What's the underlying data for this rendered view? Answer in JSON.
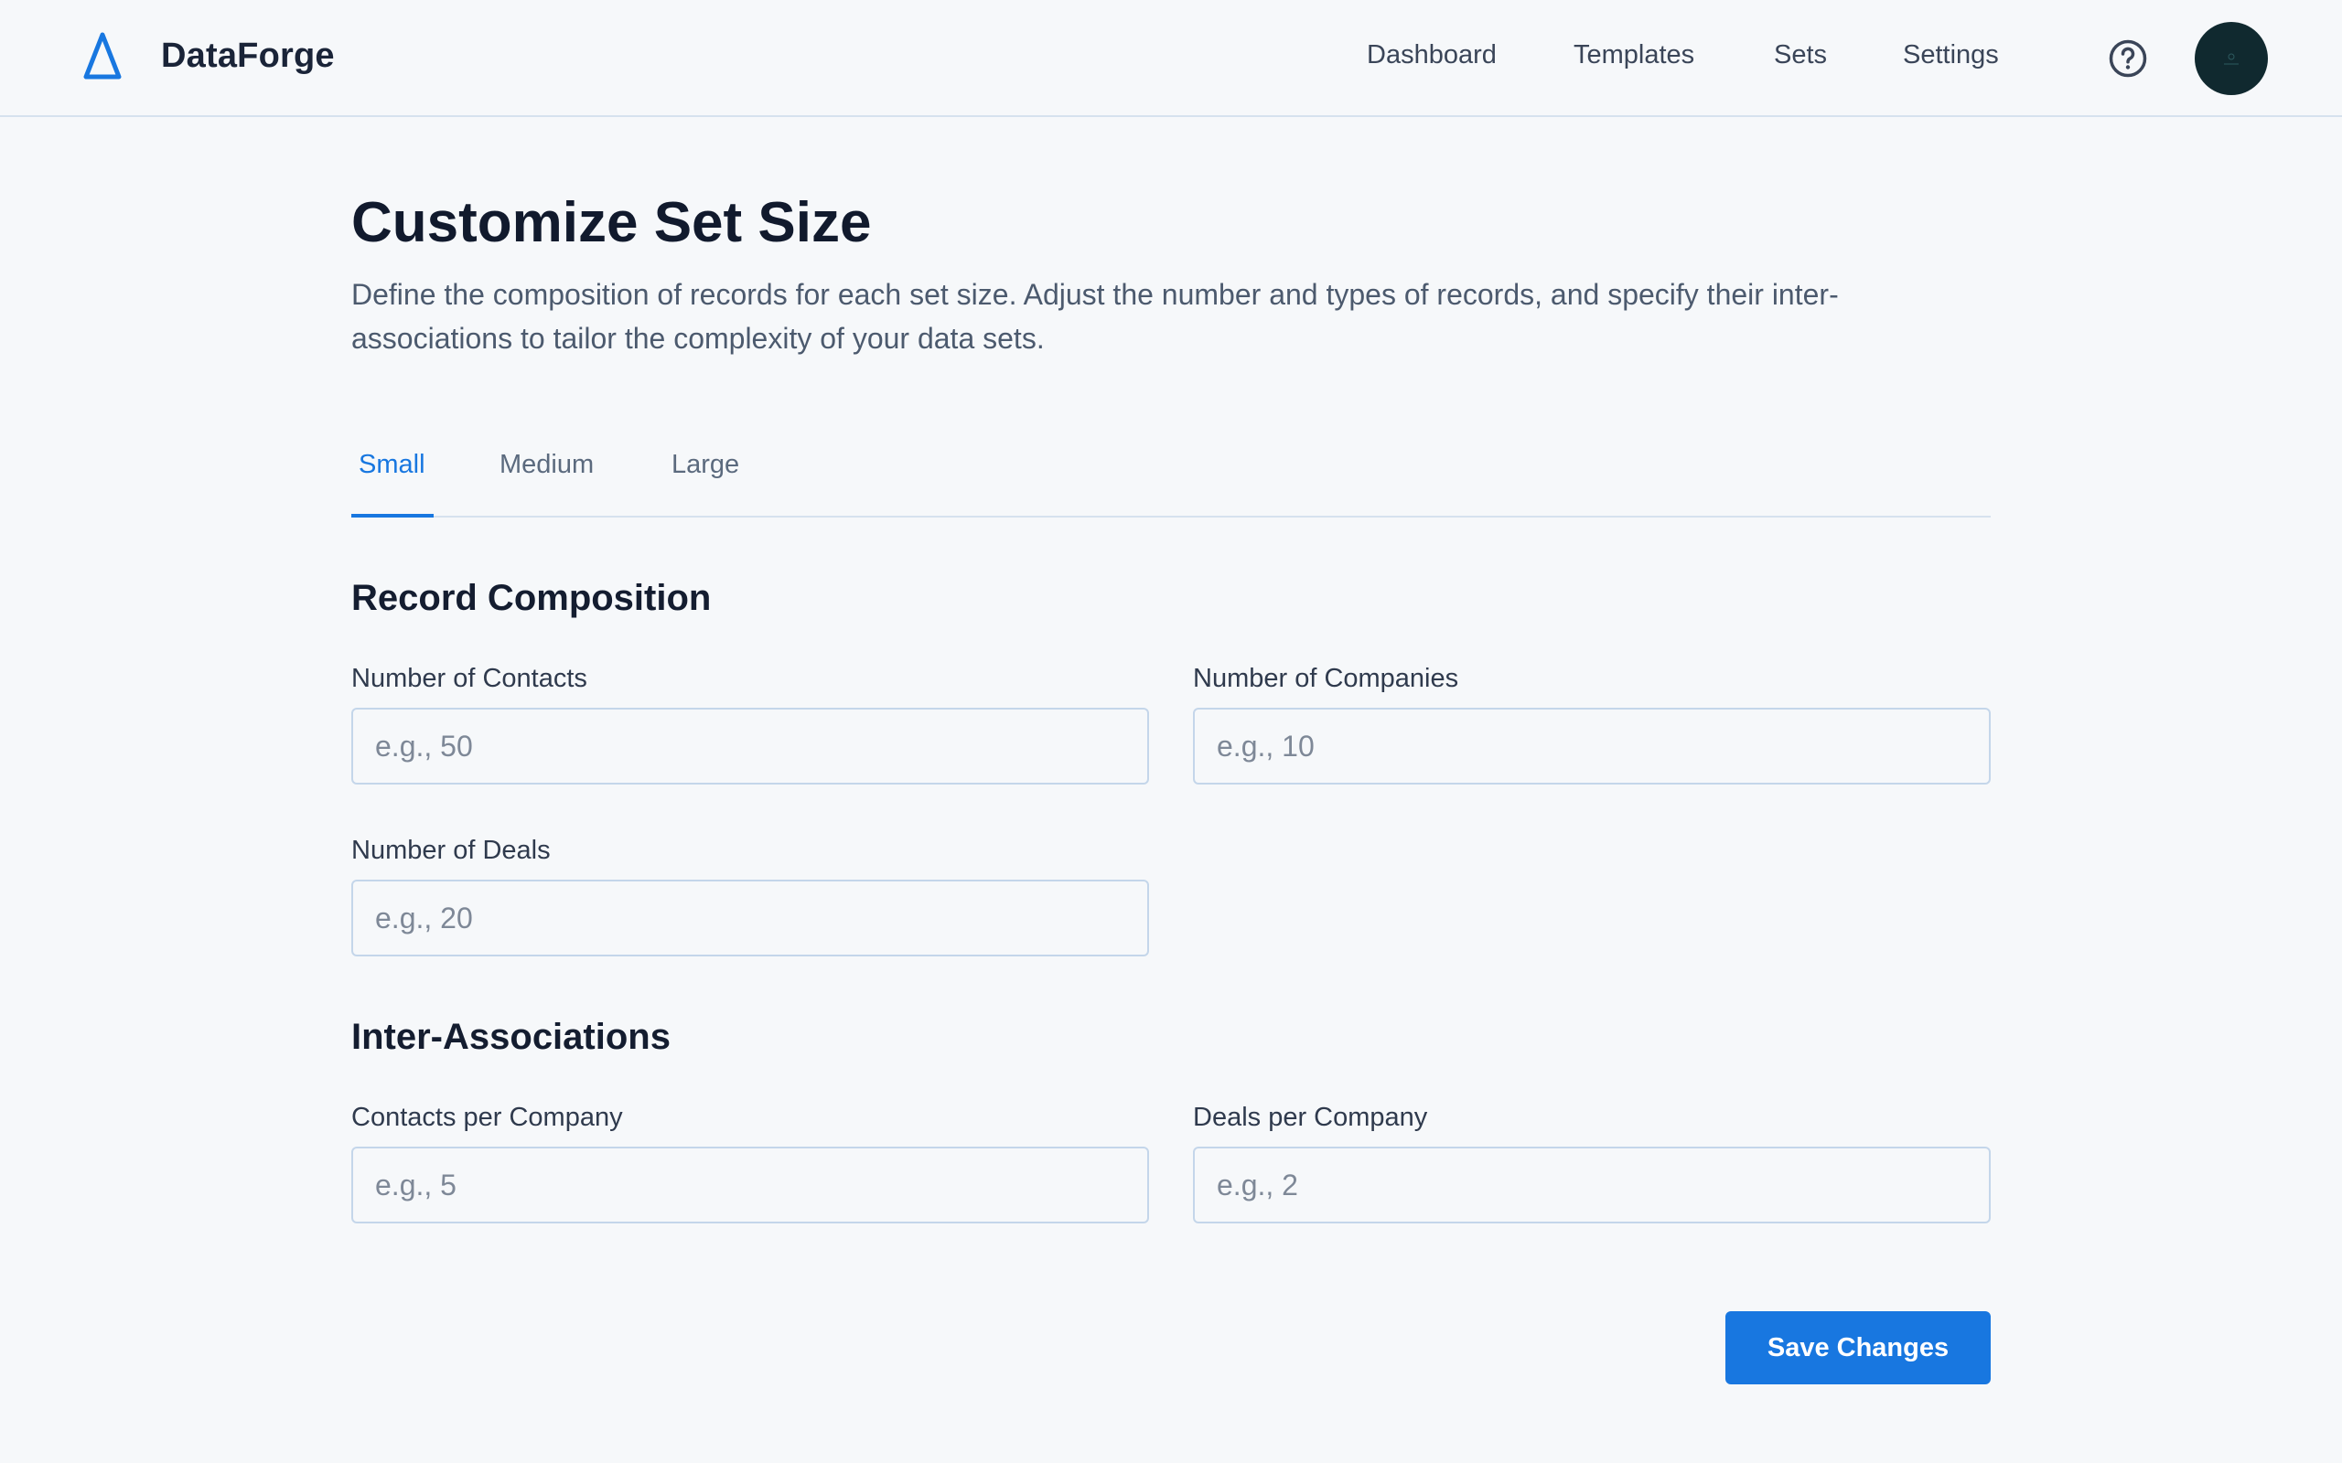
{
  "header": {
    "brand": "DataForge",
    "logo_icon": "triangle-logo-icon",
    "nav": [
      {
        "label": "Dashboard"
      },
      {
        "label": "Templates"
      },
      {
        "label": "Sets"
      },
      {
        "label": "Settings"
      }
    ],
    "help_icon": "question-circle-icon",
    "avatar_icon": "user-avatar"
  },
  "page": {
    "title": "Customize Set Size",
    "description": "Define the composition of records for each set size. Adjust the number and types of records, and specify their inter-associations to tailor the complexity of your data sets."
  },
  "tabs": [
    {
      "label": "Small",
      "active": true
    },
    {
      "label": "Medium",
      "active": false
    },
    {
      "label": "Large",
      "active": false
    }
  ],
  "record_composition": {
    "title": "Record Composition",
    "contacts": {
      "label": "Number of Contacts",
      "value": "",
      "placeholder": "e.g., 50"
    },
    "companies": {
      "label": "Number of Companies",
      "value": "",
      "placeholder": "e.g., 10"
    },
    "deals": {
      "label": "Number of Deals",
      "value": "",
      "placeholder": "e.g., 20"
    }
  },
  "inter_associations": {
    "title": "Inter-Associations",
    "contacts_per_company": {
      "label": "Contacts per Company",
      "value": "",
      "placeholder": "e.g., 5"
    },
    "deals_per_company": {
      "label": "Deals per Company",
      "value": "",
      "placeholder": "e.g., 2"
    }
  },
  "actions": {
    "save_label": "Save Changes"
  },
  "colors": {
    "accent": "#1877e0",
    "background": "#f6f8fa",
    "border": "#c4d6ea",
    "avatar_bg": "#10292f"
  }
}
